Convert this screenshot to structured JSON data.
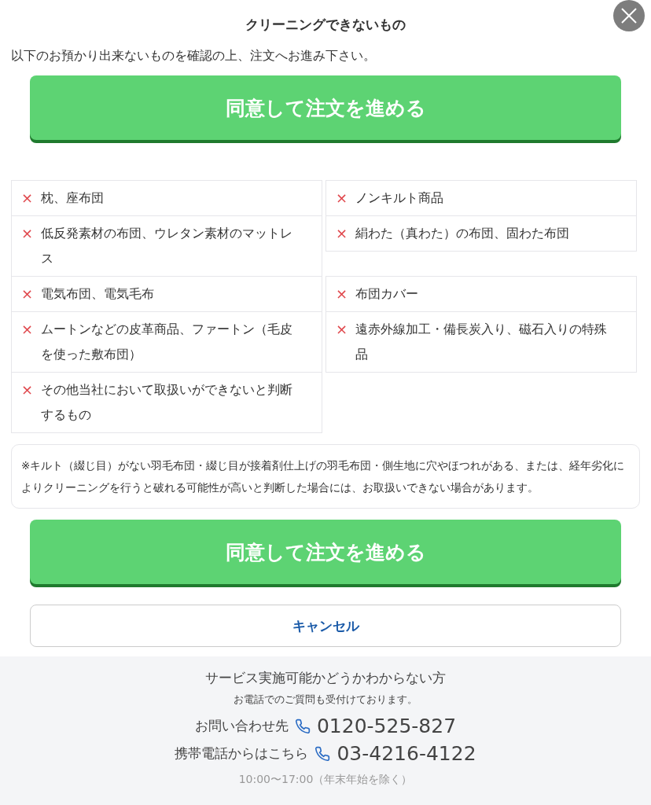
{
  "dialog": {
    "title": "クリーニングできないもの",
    "intro": "以下のお預かり出来ないものを確認の上、注文へお進み下さい。"
  },
  "buttons": {
    "agree_top": "同意して注文を進める",
    "agree_bottom": "同意して注文を進める",
    "cancel": "キャンセル"
  },
  "items": [
    {
      "mark": "×",
      "text": "枕、座布団"
    },
    {
      "mark": "×",
      "text": "ノンキルト商品"
    },
    {
      "mark": "×",
      "text": "低反発素材の布団、ウレタン素材のマットレス"
    },
    {
      "mark": "×",
      "text": "絹わた（真わた）の布団、固わた布団"
    },
    {
      "mark": "×",
      "text": "電気布団、電気毛布"
    },
    {
      "mark": "×",
      "text": "布団カバー"
    },
    {
      "mark": "×",
      "text": "ムートンなどの皮革商品、ファートン（毛皮を使った敷布団）"
    },
    {
      "mark": "×",
      "text": "遠赤外線加工・備長炭入り、磁石入りの特殊品"
    },
    {
      "mark": "×",
      "text": "その他当社において取扱いができないと判断するもの"
    }
  ],
  "note": "※キルト（綴じ目）がない羽毛布団・綴じ目が接着剤仕上げの羽毛布団・側生地に穴やほつれがある、または、経年劣化によりクリーニングを行うと破れる可能性が高いと判断した場合には、お取扱いできない場合があります。",
  "footer": {
    "heading": "サービス実施可能かどうかわからない方",
    "subheading": "お電話でのご質問も受付けております。",
    "contacts": [
      {
        "label": "お問い合わせ先",
        "number": "0120-525-827"
      },
      {
        "label": "携帯電話からはこちら",
        "number": "03-4216-4122"
      }
    ],
    "hours": "10:00〜17:00（年末年始を除く）"
  }
}
